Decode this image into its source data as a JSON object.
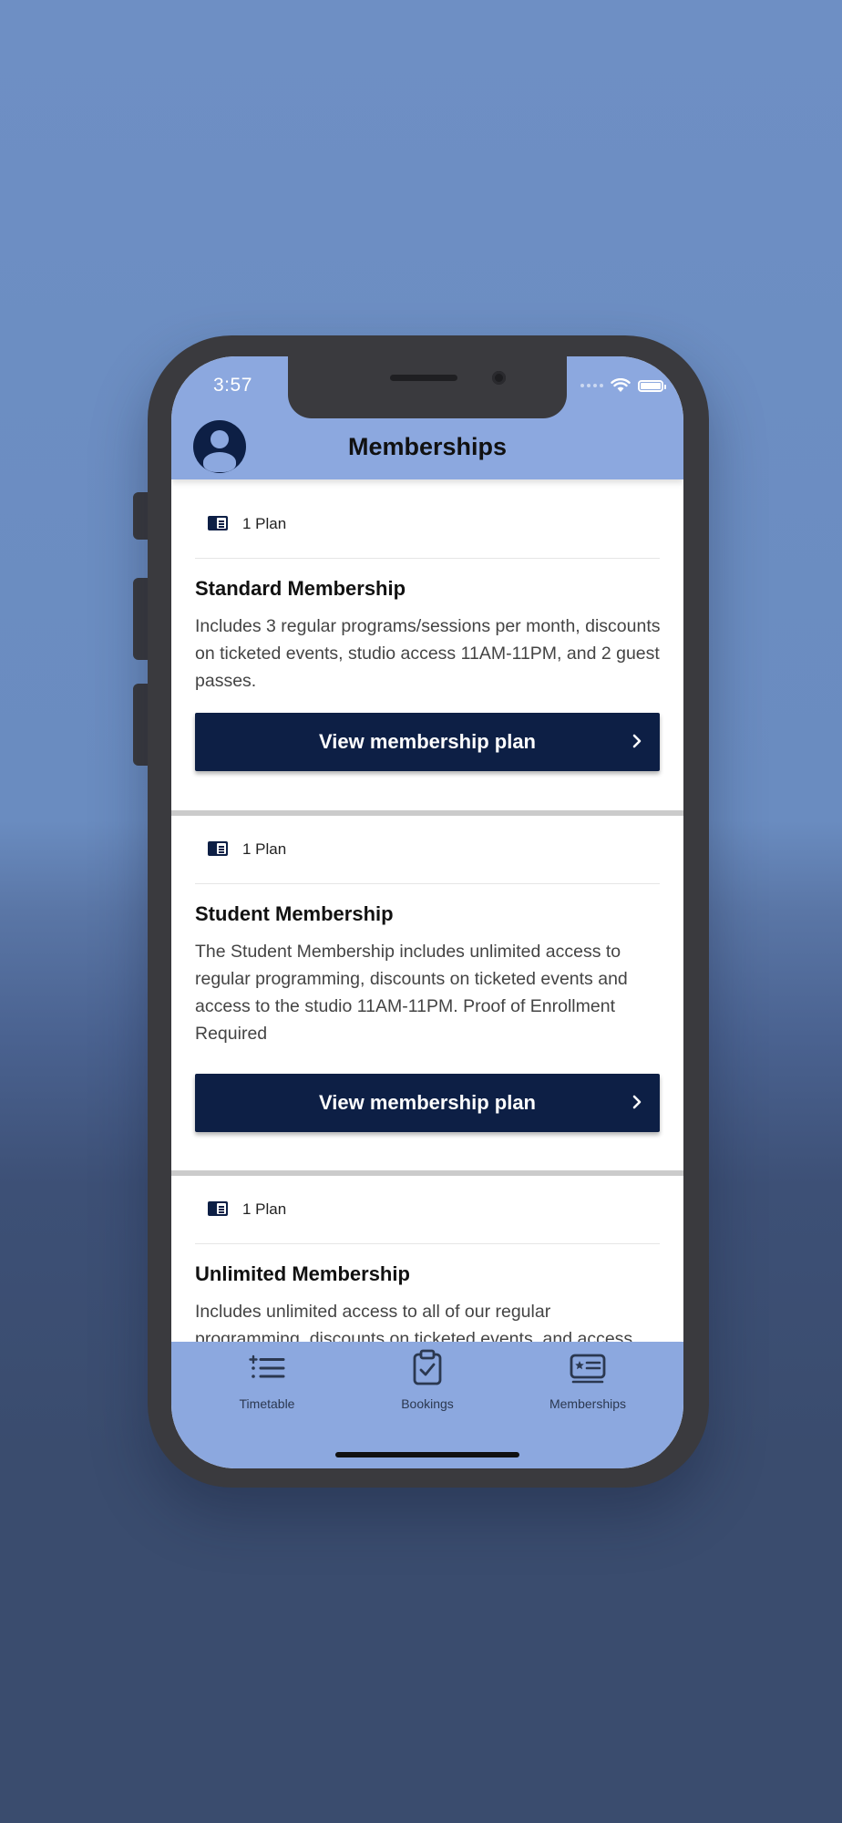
{
  "status_bar": {
    "time": "3:57"
  },
  "header": {
    "title": "Memberships"
  },
  "memberships": [
    {
      "plan_count": "1 Plan",
      "name": "Standard Membership",
      "description": "Includes 3 regular programs/sessions per month, discounts on ticketed events, studio access 11AM-11PM, and 2 guest passes.",
      "button_label": "View membership plan"
    },
    {
      "plan_count": "1 Plan",
      "name": "Student Membership",
      "description": "The Student Membership includes unlimited access to regular programming, discounts on ticketed events and access to the studio 11AM-11PM. Proof of Enrollment Required",
      "button_label": "View membership plan"
    },
    {
      "plan_count": "1 Plan",
      "name": "Unlimited Membership",
      "description": "Includes unlimited access to all of our regular programming, discounts on ticketed events, and access"
    }
  ],
  "tab_bar": {
    "tabs": [
      {
        "label": "Timetable",
        "icon": "list-icon"
      },
      {
        "label": "Bookings",
        "icon": "clipboard-check-icon"
      },
      {
        "label": "Memberships",
        "icon": "membership-card-icon"
      }
    ]
  },
  "colors": {
    "header_bg": "#8ca8df",
    "button_bg": "#0d1f45",
    "background_top": "#6e8fc4",
    "background_bottom": "#3a4c6e"
  }
}
